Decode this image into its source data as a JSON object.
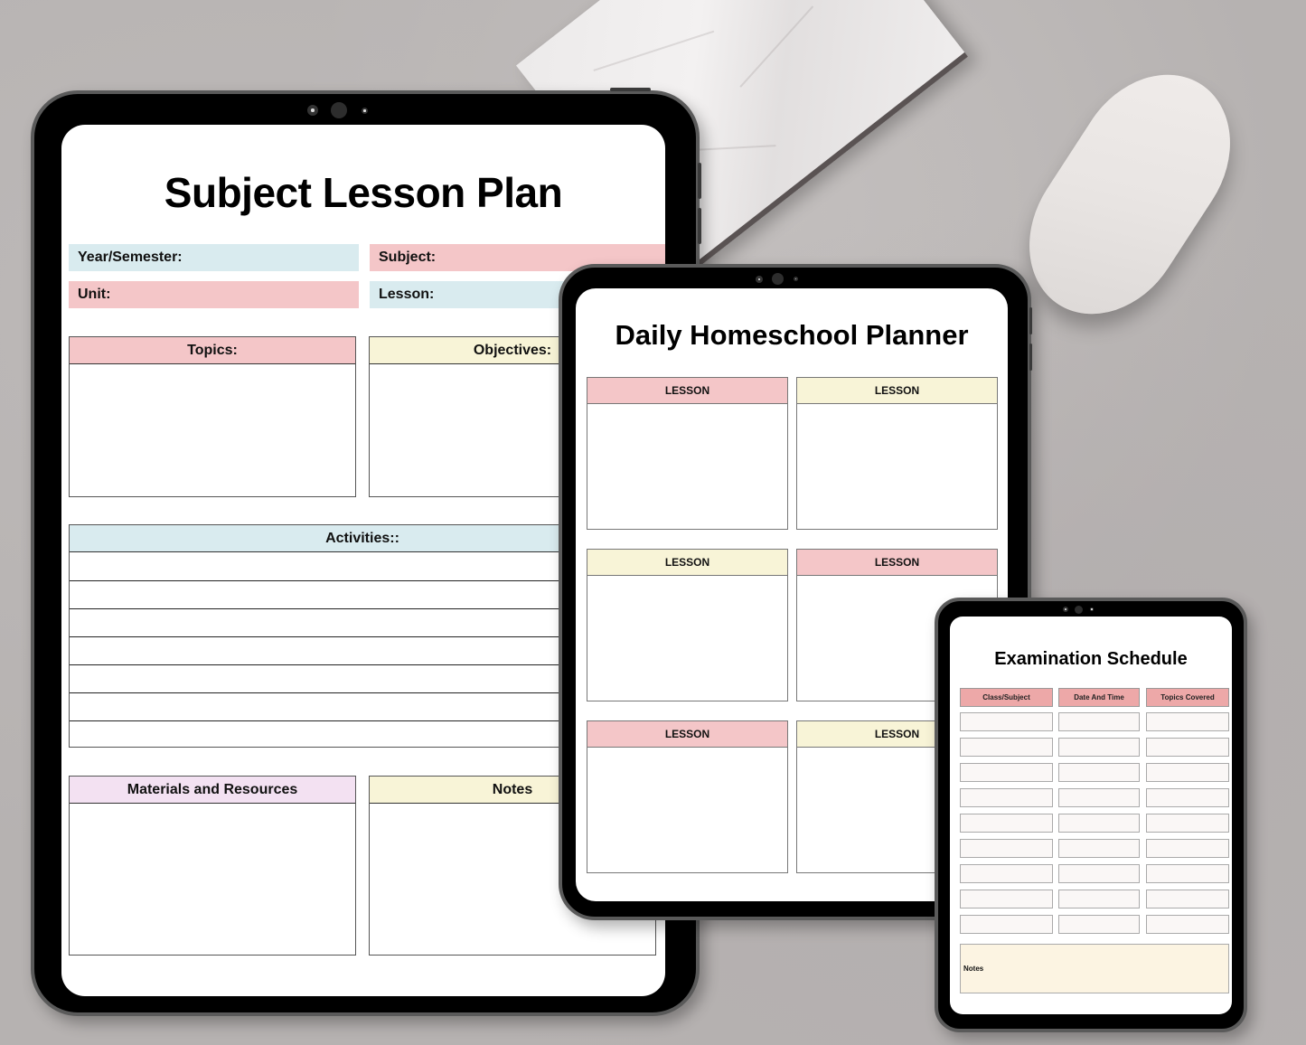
{
  "colors": {
    "pink": "#f4c6c8",
    "blue": "#d9ebef",
    "yellow": "#f8f4d7",
    "lavender": "#f3e1f2",
    "exam_header": "#eda8a8",
    "exam_notes": "#fcf4e2"
  },
  "lesson_plan": {
    "title": "Subject Lesson Plan",
    "fields": {
      "year_semester": "Year/Semester:",
      "subject": "Subject:",
      "unit": "Unit:",
      "lesson": "Lesson:"
    },
    "sections": {
      "topics": "Topics:",
      "objectives": "Objectives:",
      "activities": "Activities::",
      "materials": "Materials and Resources",
      "notes": "Notes"
    }
  },
  "daily_planner": {
    "title": "Daily Homeschool Planner",
    "lessons": [
      {
        "label": "LESSON",
        "color": "pink"
      },
      {
        "label": "LESSON",
        "color": "yellow"
      },
      {
        "label": "LESSON",
        "color": "yellow"
      },
      {
        "label": "LESSON",
        "color": "pink"
      },
      {
        "label": "LESSON",
        "color": "pink"
      },
      {
        "label": "LESSON",
        "color": "yellow"
      }
    ]
  },
  "exam_schedule": {
    "title": "Examination Schedule",
    "columns": [
      "Class/Subject",
      "Date And Time",
      "Topics Covered"
    ],
    "row_count": 9,
    "notes_label": "Notes"
  }
}
